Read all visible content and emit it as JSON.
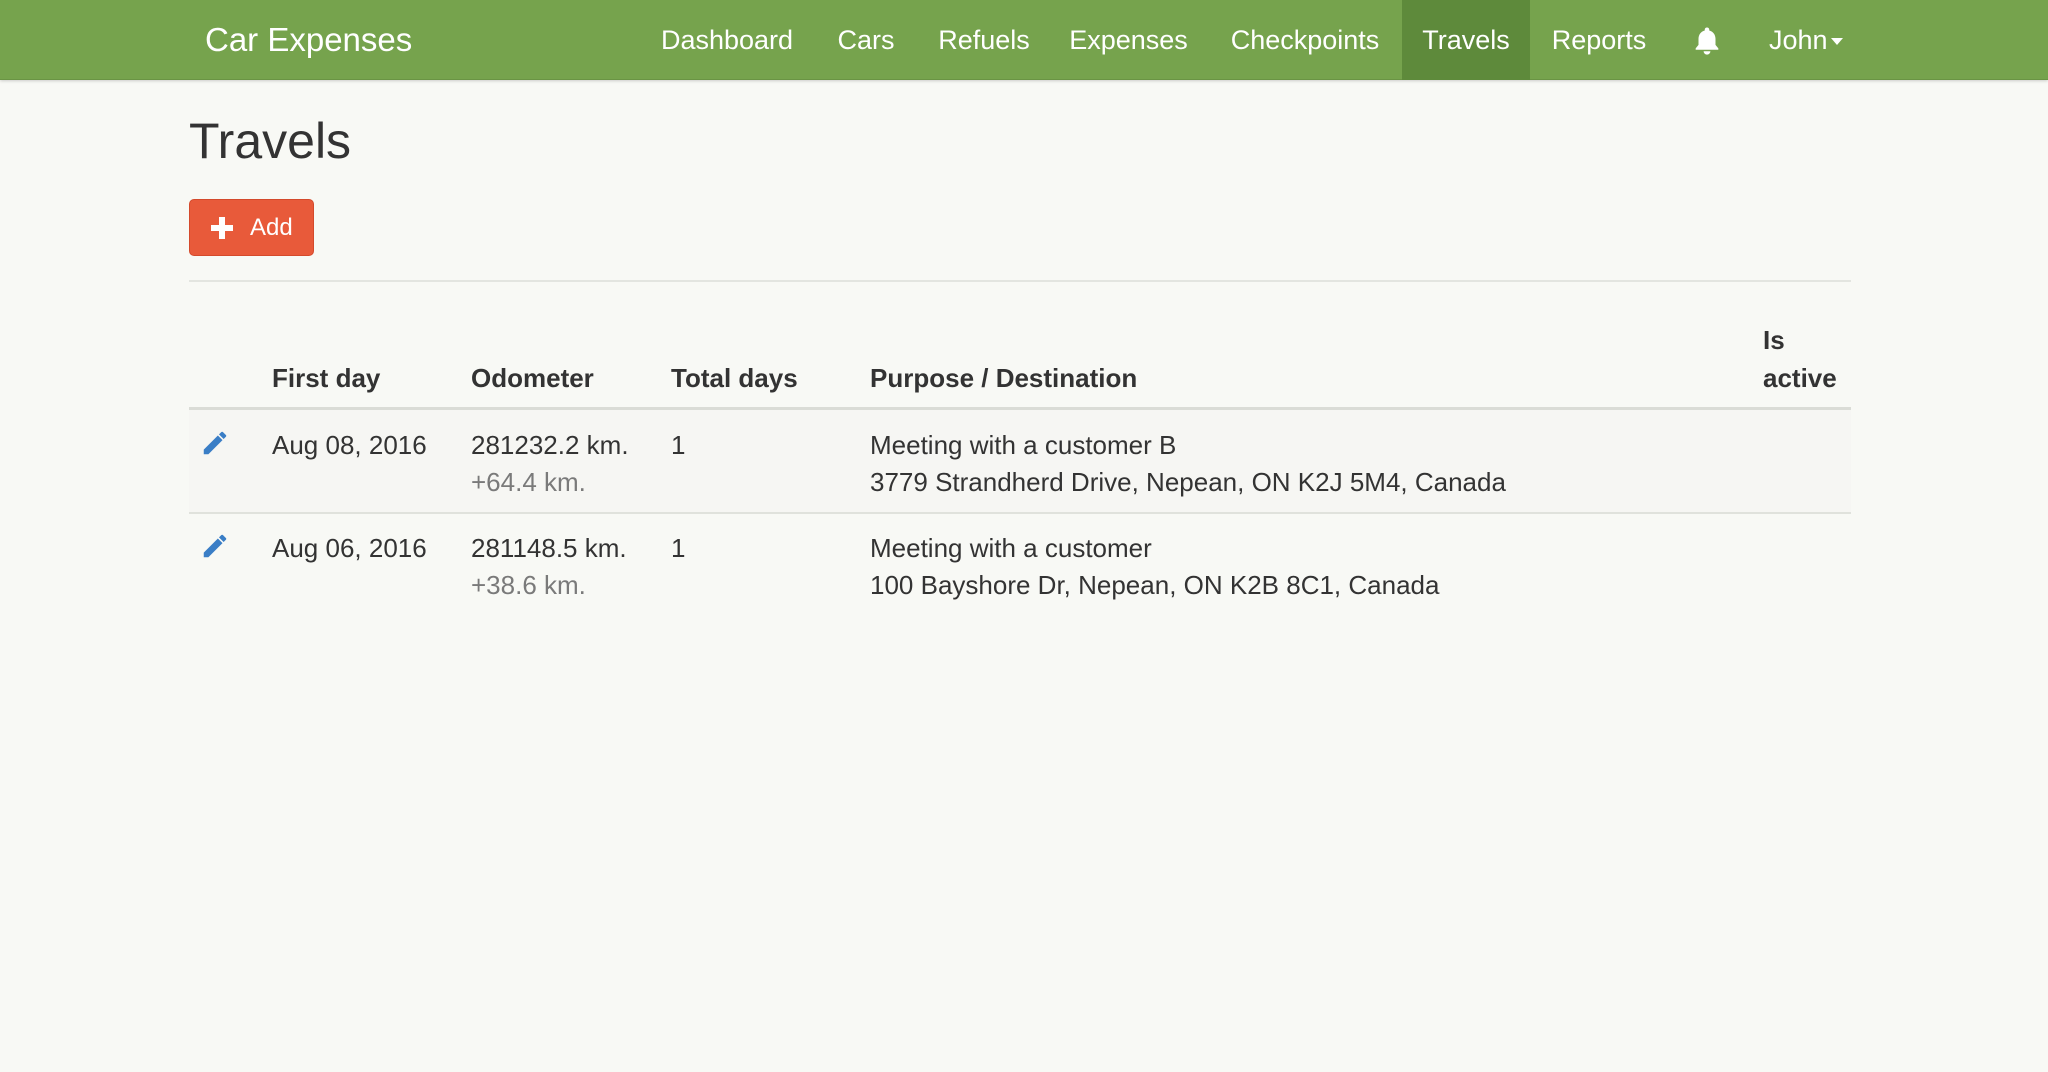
{
  "app": {
    "brand": "Car Expenses"
  },
  "nav": {
    "items": [
      {
        "label": "Dashboard"
      },
      {
        "label": "Cars"
      },
      {
        "label": "Refuels"
      },
      {
        "label": "Expenses"
      },
      {
        "label": "Checkpoints"
      },
      {
        "label": "Travels",
        "active": true
      },
      {
        "label": "Reports"
      }
    ],
    "bell_icon": "bell-icon",
    "user": "John"
  },
  "page": {
    "title": "Travels",
    "add_label": "Add"
  },
  "table": {
    "headers": {
      "first_day": "First day",
      "odometer": "Odometer",
      "total_days": "Total days",
      "purpose": "Purpose / Destination",
      "is_active_1": "Is",
      "is_active_2": "active"
    },
    "rows": [
      {
        "first_day": "Aug 08, 2016",
        "odometer": "281232.2 km.",
        "distance": "+64.4 km.",
        "total_days": "1",
        "purpose": "Meeting with a customer B",
        "destination": "3779 Strandherd Drive, Nepean, ON K2J 5M4, Canada"
      },
      {
        "first_day": "Aug 06, 2016",
        "odometer": "281148.5 km.",
        "distance": "+38.6 km.",
        "total_days": "1",
        "purpose": "Meeting with a customer",
        "destination": "100 Bayshore Dr, Nepean, ON K2B 8C1, Canada"
      }
    ]
  },
  "colors": {
    "navbar": "#76a34d",
    "navbar_active": "#5e8a3b",
    "add_button": "#e85a3a",
    "edit_icon": "#3a7ec6"
  }
}
